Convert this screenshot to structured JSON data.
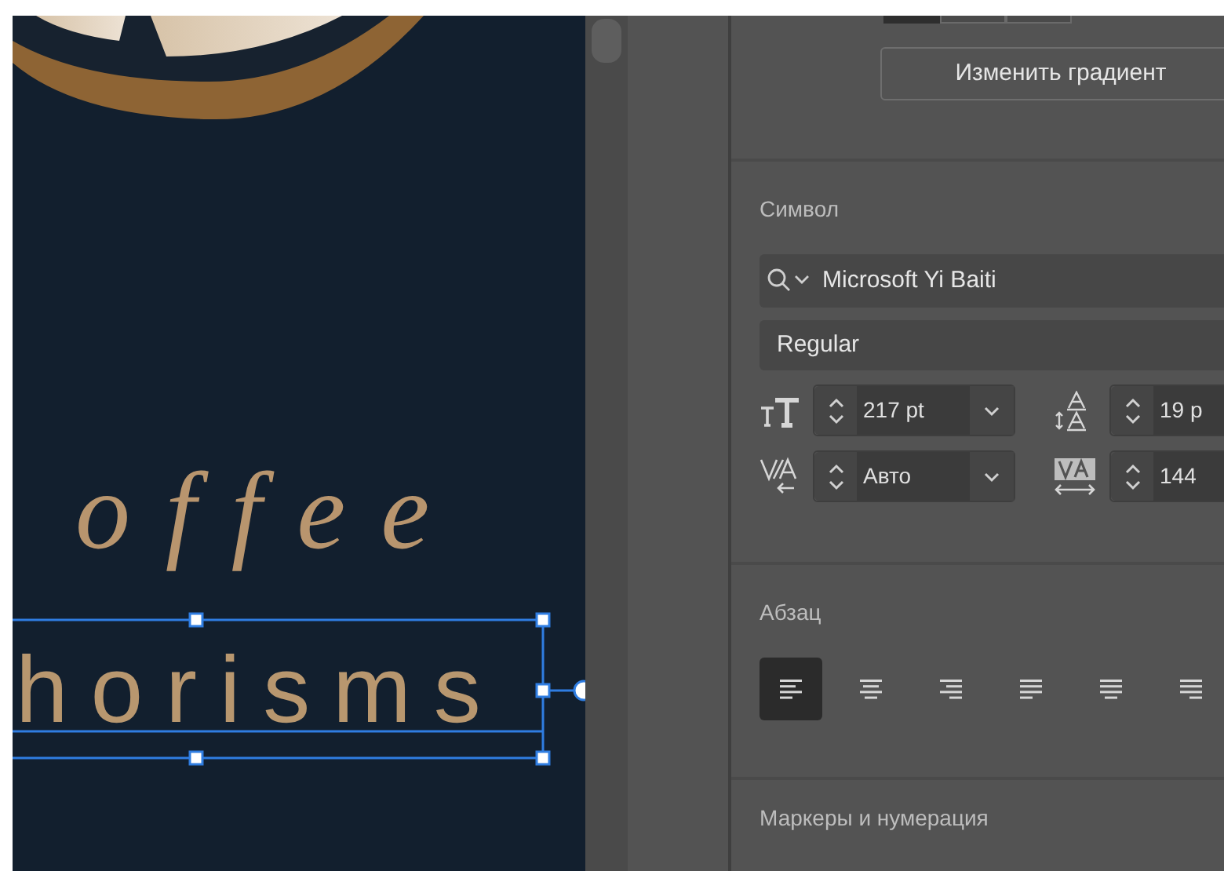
{
  "canvas": {
    "headline": "offee",
    "subline": "horisms",
    "selected": true
  },
  "panel": {
    "gradient_button": "Изменить градиент",
    "character": {
      "title": "Символ",
      "font_family": "Microsoft Yi Baiti",
      "font_style": "Regular",
      "font_size": "217 pt",
      "leading": "19 p",
      "kerning": "Авто",
      "tracking": "144"
    },
    "paragraph": {
      "title": "Абзац",
      "alignments": [
        {
          "kind": "left",
          "selected": true
        },
        {
          "kind": "center",
          "selected": false
        },
        {
          "kind": "right",
          "selected": false
        },
        {
          "kind": "justify-left",
          "selected": false
        },
        {
          "kind": "justify-center",
          "selected": false
        },
        {
          "kind": "justify-right",
          "selected": false
        }
      ]
    },
    "bullets": {
      "title": "Маркеры и нумерация"
    }
  }
}
